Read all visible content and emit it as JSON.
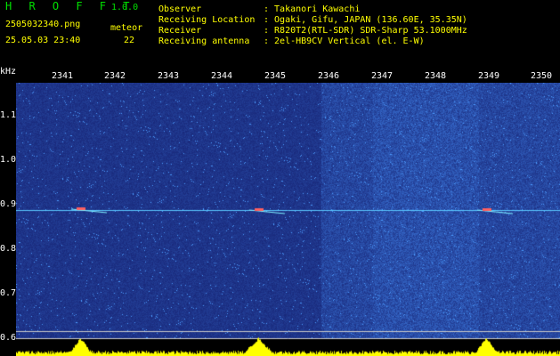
{
  "header": {
    "app_title": "H R O F F T",
    "version": "1.0.0",
    "filename": "2505032340.png",
    "timestamp": "25.05.03 23:40",
    "meteor_label": "meteor",
    "meteor_count": "22"
  },
  "info": [
    {
      "key": "Observer",
      "value": ": Takanori Kawachi"
    },
    {
      "key": "Receiving Location",
      "value": ": Ogaki, Gifu, JAPAN (136.60E, 35.35N)"
    },
    {
      "key": "Receiver",
      "value": ": R820T2(RTL-SDR) SDR-Sharp 53.1000MHz"
    },
    {
      "key": "Receiving antenna",
      "value": ": 2el-HB9CV Vertical (el. E-W)"
    }
  ],
  "axes": {
    "y_unit": "kHz",
    "y_ticks": [
      "1.1",
      "1.0",
      "0.9",
      "0.8",
      "0.7",
      "0.6"
    ],
    "x_ticks": [
      "2341",
      "2342",
      "2343",
      "2344",
      "2345",
      "2346",
      "2347",
      "2348",
      "2349",
      "2350"
    ]
  },
  "colors": {
    "background": "#000000",
    "waterfall_base": "#16207a",
    "signal_line": "#5ac8ff",
    "meteor_head": "#ff6060",
    "level_bars": "#ffff00",
    "header_green": "#00e000",
    "header_yellow": "#ffff00"
  }
}
